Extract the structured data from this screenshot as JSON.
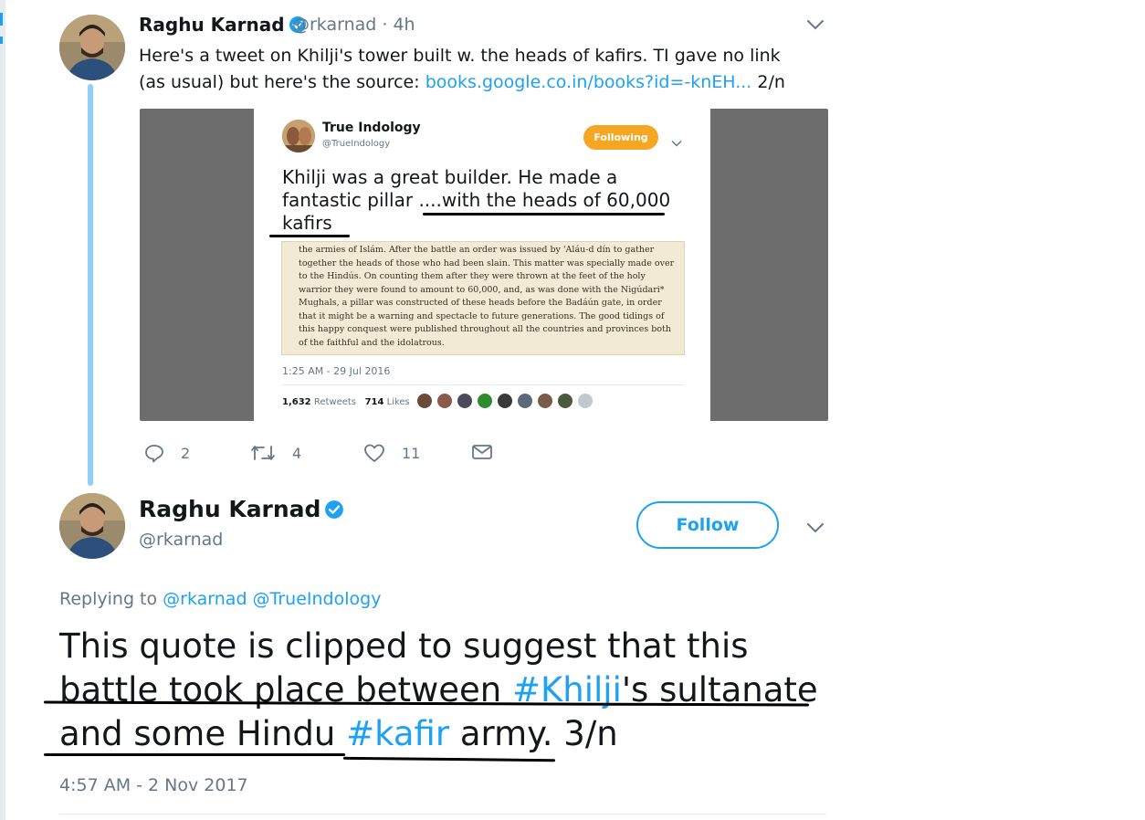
{
  "tweet1": {
    "author_name": "Raghu Karnad",
    "handle_time": "@rkarnad · 4h",
    "text_before_link": "Here's a tweet on Khilji's tower built w. the heads of kafirs. TI gave no link (as usual) but here's the source: ",
    "link_text": "books.google.co.in/books?id=-knEH...",
    "text_after_link": " 2/n",
    "embedded": {
      "author_name": "True Indology",
      "handle": "@TrueIndology",
      "follow_label": "Following",
      "text": "Khilji was a great builder. He made a fantastic pillar ....with the heads of 60,000 kafirs",
      "book_excerpt": "the armies of Islám. After the battle an order was issued by 'Aláu-d dín to gather together the heads of those who had been slain. This matter was specially made over to the Hindús. On counting them after they were thrown at the feet of the holy warrior they were found to amount to 60,000, and, as was done with the Nigúdari* Mughals, a pillar was constructed of these heads before the Badáún gate, in order that it might be a warning and spectacle to future generations. The good tidings of this happy conquest were published throughout all the countries and provinces both of the faithful and the idolatrous.",
      "timestamp": "1:25 AM - 29 Jul 2016",
      "retweets_count": "1,632",
      "retweets_label": "Retweets",
      "likes_count": "714",
      "likes_label": "Likes"
    },
    "reply_count": "2",
    "retweet_count": "4",
    "like_count": "11"
  },
  "tweet2": {
    "author_name": "Raghu Karnad",
    "handle": "@rkarnad",
    "follow_label": "Follow",
    "replying_prefix": "Replying to ",
    "replying_to": "@rkarnad @TrueIndology",
    "text_part1": "This quote is clipped to suggest that this battle took place between ",
    "hashtag1": "#Khilji",
    "text_part2": "'s sultanate and some Hindu ",
    "hashtag2": "#kafir",
    "text_part3": " army. 3/n",
    "timestamp": "4:57 AM - 2 Nov 2017"
  },
  "colors": {
    "accent": "#1da1f2",
    "secondary_text": "#657786",
    "following_pill": "#f5a623",
    "thread_line": "#8ed0f9"
  },
  "icons": [
    "verified-badge-icon",
    "chevron-down-icon",
    "reply-icon",
    "retweet-icon",
    "like-icon",
    "direct-message-icon"
  ]
}
